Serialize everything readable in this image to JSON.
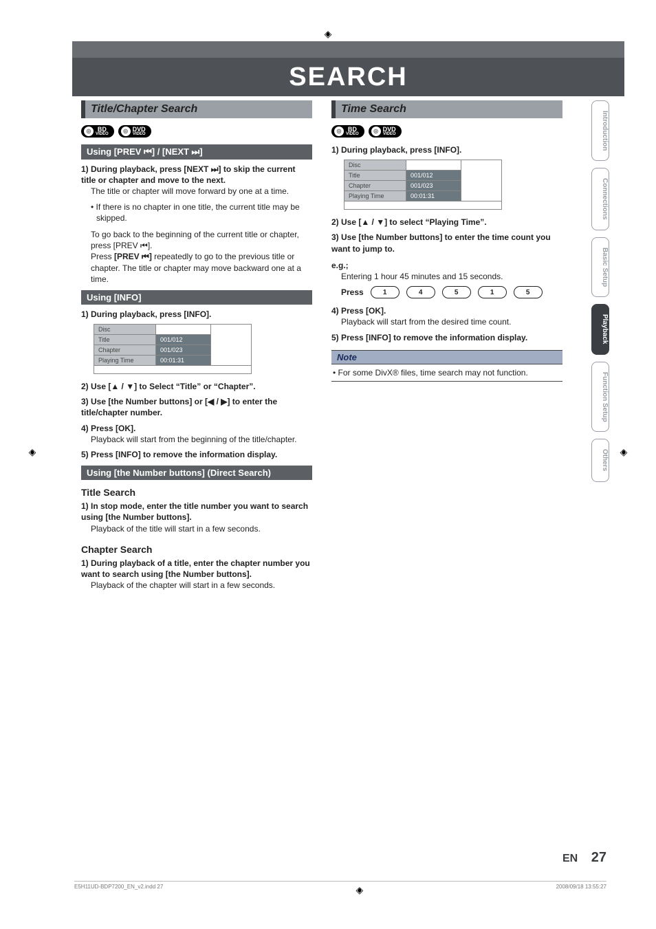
{
  "page_title": "SEARCH",
  "sections": {
    "left": {
      "title": "Title/Chapter Search",
      "badges": [
        "BD VIDEO",
        "DVD VIDEO"
      ],
      "sub1": {
        "heading": "Using [PREV ⏮] / [NEXT ⏭]",
        "step1_bold": "1) During playback, press [NEXT ⏭] to skip the current title or chapter and move to the next.",
        "step1_body": "The title or chapter will move forward by one at a time.",
        "step1_bullet": "• If there is no chapter in one title, the current title may be skipped.",
        "step1_para2": "To go back to the beginning of the current title or chapter, press [PREV ⏮].",
        "step1_para3_a": "Press ",
        "step1_para3_b": "[PREV ⏮]",
        "step1_para3_c": " repeatedly to go to the previous title or chapter. The title or chapter may move backward one at a time."
      },
      "sub2": {
        "heading": "Using [INFO]",
        "step1": "1) During playback, press [INFO].",
        "table": {
          "rows": [
            {
              "label": "Disc",
              "value": ""
            },
            {
              "label": "Title",
              "value": "001/012"
            },
            {
              "label": "Chapter",
              "value": "001/023"
            },
            {
              "label": "Playing Time",
              "value": "00:01:31"
            }
          ]
        },
        "step2": "2) Use [▲ / ▼] to Select “Title” or “Chapter”.",
        "step3": "3) Use [the Number buttons] or [◀ / ▶] to enter the title/chapter number.",
        "step4": "4) Press [OK].",
        "step4_body": "Playback will start from the beginning of the title/chapter.",
        "step5": "5) Press [INFO] to remove the information display."
      },
      "sub3": {
        "heading": "Using [the Number buttons] (Direct Search)",
        "title_search_h": "Title Search",
        "ts_step1": "1) In stop mode, enter the title number you want to search using [the Number buttons].",
        "ts_step1_body": "Playback of the title will start in a few seconds.",
        "chapter_search_h": "Chapter Search",
        "cs_step1": "1) During playback of a title, enter the chapter number you want to search using [the Number buttons].",
        "cs_step1_body": "Playback of the chapter will start in a few seconds."
      }
    },
    "right": {
      "title": "Time Search",
      "badges": [
        "BD VIDEO",
        "DVD VIDEO"
      ],
      "step1": "1) During playback, press [INFO].",
      "table": {
        "rows": [
          {
            "label": "Disc",
            "value": ""
          },
          {
            "label": "Title",
            "value": "001/012"
          },
          {
            "label": "Chapter",
            "value": "001/023"
          },
          {
            "label": "Playing Time",
            "value": "00:01:31"
          }
        ]
      },
      "step2": "2) Use [▲ / ▼] to select “Playing Time”.",
      "step3": "3) Use [the Number buttons] to enter the time count you want to jump to.",
      "eg_label": "e.g.;",
      "eg_body": "Entering 1 hour 45 minutes and 15 seconds.",
      "press_label": "Press",
      "keys": [
        "1",
        "4",
        "5",
        "1",
        "5"
      ],
      "step4": "4) Press [OK].",
      "step4_body": "Playback will start from the desired time count.",
      "step5": "5) Press [INFO] to remove the information display.",
      "note_head": "Note",
      "note_body": "• For some DivX® files, time search may not function."
    }
  },
  "tabs": [
    "Introduction",
    "Connections",
    "Basic Setup",
    "Playback",
    "Function Setup",
    "Others"
  ],
  "active_tab_index": 3,
  "page_number": {
    "lang": "EN",
    "num": "27"
  },
  "footer": {
    "left": "E5H11UD-BDP7200_EN_v2.indd   27",
    "right": "2008/09/18   13:55:27"
  }
}
